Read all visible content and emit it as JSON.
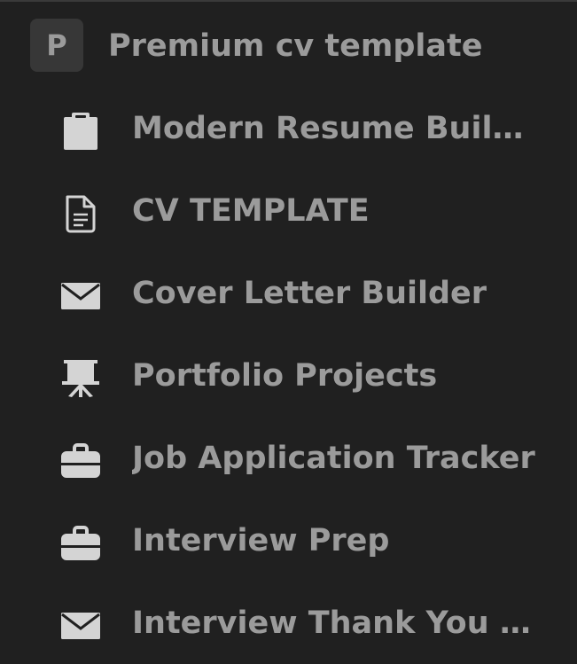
{
  "workspace": {
    "avatar_letter": "P",
    "title": "Premium cv template"
  },
  "pages": [
    {
      "label": "Modern Resume Builder",
      "icon": "clipboard-icon"
    },
    {
      "label": "CV TEMPLATE",
      "icon": "document-icon"
    },
    {
      "label": "Cover Letter Builder",
      "icon": "envelope-icon"
    },
    {
      "label": "Portfolio Projects",
      "icon": "presentation-easel-icon"
    },
    {
      "label": "Job Application Tracker",
      "icon": "briefcase-icon"
    },
    {
      "label": "Interview Prep",
      "icon": "briefcase-icon"
    },
    {
      "label": "Interview Thank You N...",
      "icon": "envelope-icon"
    }
  ],
  "colors": {
    "background": "#202020",
    "text": "#9b9b9b",
    "icon": "#d4d4d4",
    "avatar_bg": "#373737"
  }
}
